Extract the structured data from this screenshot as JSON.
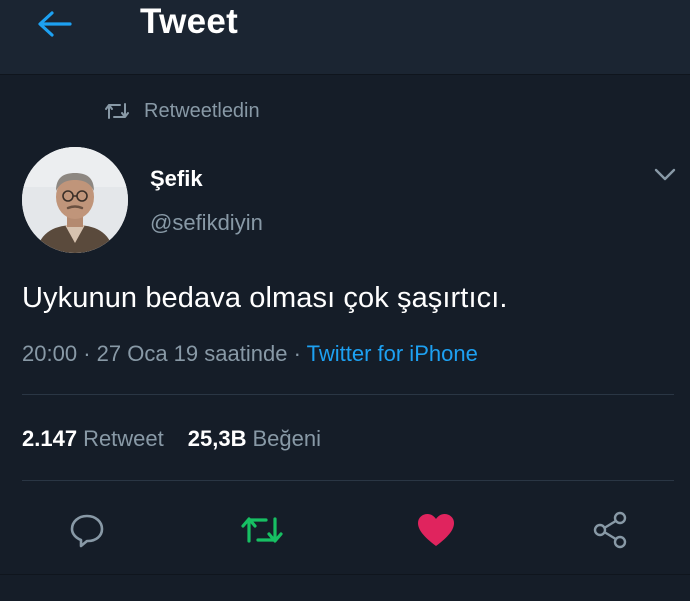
{
  "header": {
    "title": "Tweet",
    "back_icon": "arrow-left-icon"
  },
  "retweet_context": {
    "label": "Retweetledin",
    "icon": "retweet-icon"
  },
  "author": {
    "name": "Şefik",
    "handle": "@sefikdiyin",
    "avatar_icon": "user-avatar"
  },
  "tweet": {
    "text": "Uykunun bedava olması çok şaşırtıcı."
  },
  "meta": {
    "time": "20:00",
    "separator": "·",
    "date_text": "27 Oca 19 saatinde",
    "source": "Twitter for iPhone"
  },
  "stats": {
    "retweets": {
      "count": "2.147",
      "label": "Retweet"
    },
    "likes": {
      "count": "25,3B",
      "label": "Beğeni"
    }
  },
  "actions": [
    {
      "name": "reply",
      "icon": "reply-icon"
    },
    {
      "name": "retweet",
      "icon": "retweet-icon",
      "active": true
    },
    {
      "name": "like",
      "icon": "heart-icon",
      "active": true
    },
    {
      "name": "share",
      "icon": "share-icon"
    }
  ],
  "colors": {
    "background": "#151d28",
    "header_background": "#1b2532",
    "accent": "#1da1f2",
    "muted_text": "#8899a6",
    "retweet_active": "#17bf63",
    "like_active": "#e0245e"
  }
}
